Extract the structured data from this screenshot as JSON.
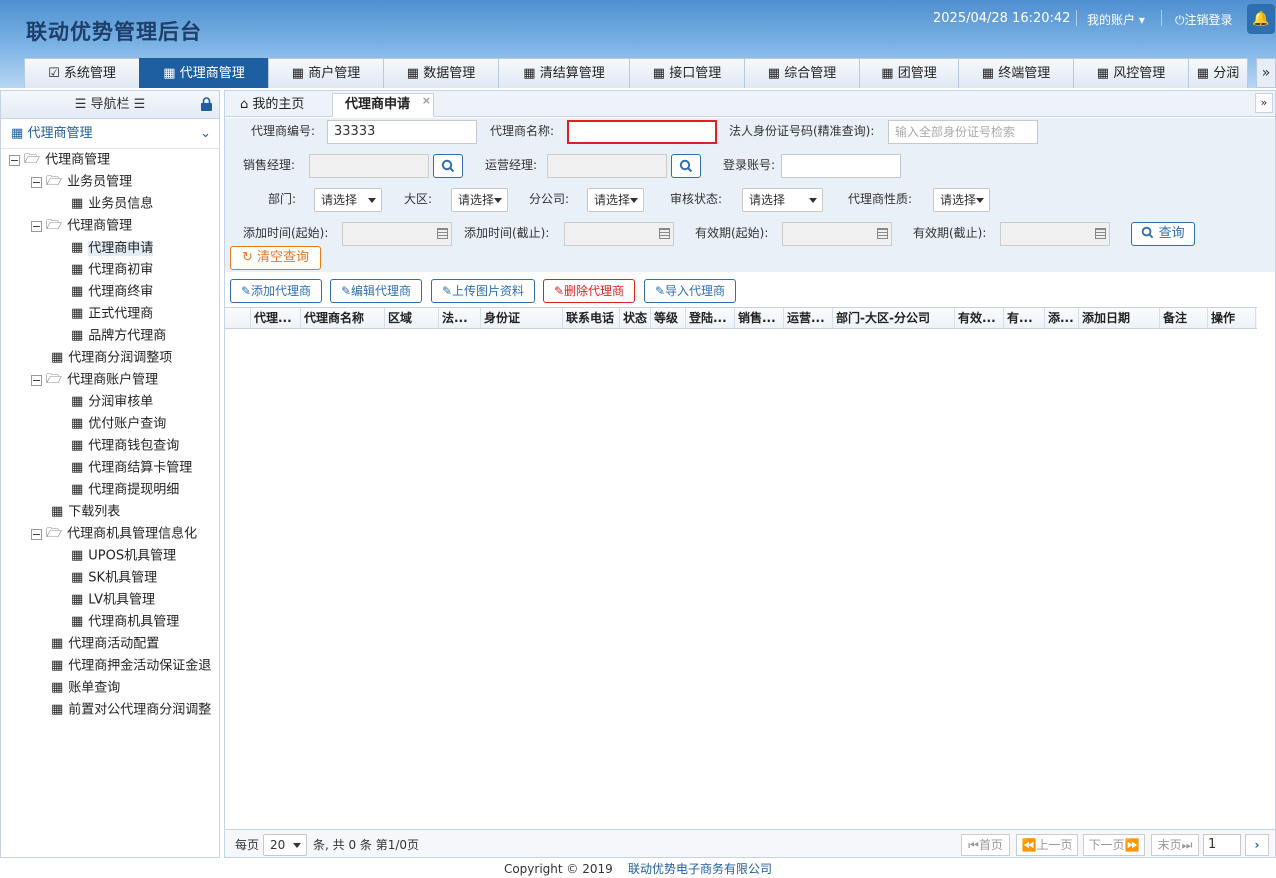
{
  "header": {
    "title": "联动优势管理后台",
    "datetime": "2025/04/28 16:20:42",
    "account": "我的账户",
    "logout": "注销登录"
  },
  "topnav": [
    {
      "label": "系统管理",
      "icon": "check-square-icon"
    },
    {
      "label": "代理商管理",
      "icon": "table-icon",
      "active": true
    },
    {
      "label": "商户管理",
      "icon": "table-icon"
    },
    {
      "label": "数据管理",
      "icon": "table-icon"
    },
    {
      "label": "清结算管理",
      "icon": "table-icon"
    },
    {
      "label": "接口管理",
      "icon": "table-icon"
    },
    {
      "label": "综合管理",
      "icon": "table-icon"
    },
    {
      "label": "团管理",
      "icon": "table-icon"
    },
    {
      "label": "终端管理",
      "icon": "table-icon"
    },
    {
      "label": "风控管理",
      "icon": "table-icon"
    },
    {
      "label": "分润",
      "icon": "table-icon"
    }
  ],
  "sidebar": {
    "title": "导航栏",
    "section": "代理商管理",
    "tree": [
      {
        "label": "代理商管理",
        "type": "folder",
        "level": 0
      },
      {
        "label": "业务员管理",
        "type": "folder",
        "level": 1
      },
      {
        "label": "业务员信息",
        "type": "leaf",
        "level": 2
      },
      {
        "label": "代理商管理",
        "type": "folder",
        "level": 1
      },
      {
        "label": "代理商申请",
        "type": "leaf",
        "level": 2,
        "selected": true
      },
      {
        "label": "代理商初审",
        "type": "leaf",
        "level": 2
      },
      {
        "label": "代理商终审",
        "type": "leaf",
        "level": 2
      },
      {
        "label": "正式代理商",
        "type": "leaf",
        "level": 2
      },
      {
        "label": "品牌方代理商",
        "type": "leaf",
        "level": 2
      },
      {
        "label": "代理商分润调整项",
        "type": "leaf",
        "level": 1
      },
      {
        "label": "代理商账户管理",
        "type": "folder",
        "level": 1
      },
      {
        "label": "分润审核单",
        "type": "leaf",
        "level": 2
      },
      {
        "label": "优付账户查询",
        "type": "leaf",
        "level": 2
      },
      {
        "label": "代理商钱包查询",
        "type": "leaf",
        "level": 2
      },
      {
        "label": "代理商结算卡管理",
        "type": "leaf",
        "level": 2
      },
      {
        "label": "代理商提现明细",
        "type": "leaf",
        "level": 2
      },
      {
        "label": "下载列表",
        "type": "leaf",
        "level": 1
      },
      {
        "label": "代理商机具管理信息化",
        "type": "folder",
        "level": 1
      },
      {
        "label": "UPOS机具管理",
        "type": "leaf",
        "level": 2
      },
      {
        "label": "SK机具管理",
        "type": "leaf",
        "level": 2
      },
      {
        "label": "LV机具管理",
        "type": "leaf",
        "level": 2
      },
      {
        "label": "代理商机具管理",
        "type": "leaf",
        "level": 2
      },
      {
        "label": "代理商活动配置",
        "type": "leaf",
        "level": 1
      },
      {
        "label": "代理商押金活动保证金退",
        "type": "leaf",
        "level": 1
      },
      {
        "label": "账单查询",
        "type": "leaf",
        "level": 1
      },
      {
        "label": "前置对公代理商分润调整",
        "type": "leaf",
        "level": 1
      }
    ]
  },
  "tabs": [
    {
      "label": "我的主页"
    },
    {
      "label": "代理商申请",
      "active": true
    }
  ],
  "search": {
    "agent_no_label": "代理商编号:",
    "agent_no_value": "33333",
    "agent_name_label": "代理商名称:",
    "agent_name_value": "",
    "id_label": "法人身份证号码(精准查询):",
    "id_placeholder": "输入全部身份证号检索",
    "sales_label": "销售经理:",
    "ops_label": "运营经理:",
    "login_label": "登录账号:",
    "dept_label": "部门:",
    "region_label": "大区:",
    "branch_label": "分公司:",
    "audit_label": "审核状态:",
    "nature_label": "代理商性质:",
    "select_placeholder": "请选择",
    "add_start_label": "添加时间(起始):",
    "add_end_label": "添加时间(截止):",
    "valid_start_label": "有效期(起始):",
    "valid_end_label": "有效期(截止):",
    "query_btn": "查询",
    "clear_btn": "清空查询"
  },
  "actions": {
    "add": "添加代理商",
    "edit": "编辑代理商",
    "upload": "上传图片资料",
    "delete": "删除代理商",
    "import": "导入代理商"
  },
  "grid": {
    "columns": [
      "代理...",
      "代理商名称",
      "区域",
      "法...",
      "身份证",
      "联系电话",
      "状态",
      "等级",
      "登陆...",
      "销售...",
      "运营...",
      "部门-大区-分公司",
      "有效...",
      "有...",
      "添...",
      "添加日期",
      "备注",
      "操作"
    ]
  },
  "pager": {
    "per_page_label": "每页",
    "per_page": "20",
    "summary": "条, 共 0 条 第1/0页",
    "first": "首页",
    "prev": "上一页",
    "next": "下一页",
    "last": "末页",
    "page": "1"
  },
  "footer": {
    "copyright": "Copyright © 2019",
    "company": "联动优势电子商务有限公司"
  }
}
